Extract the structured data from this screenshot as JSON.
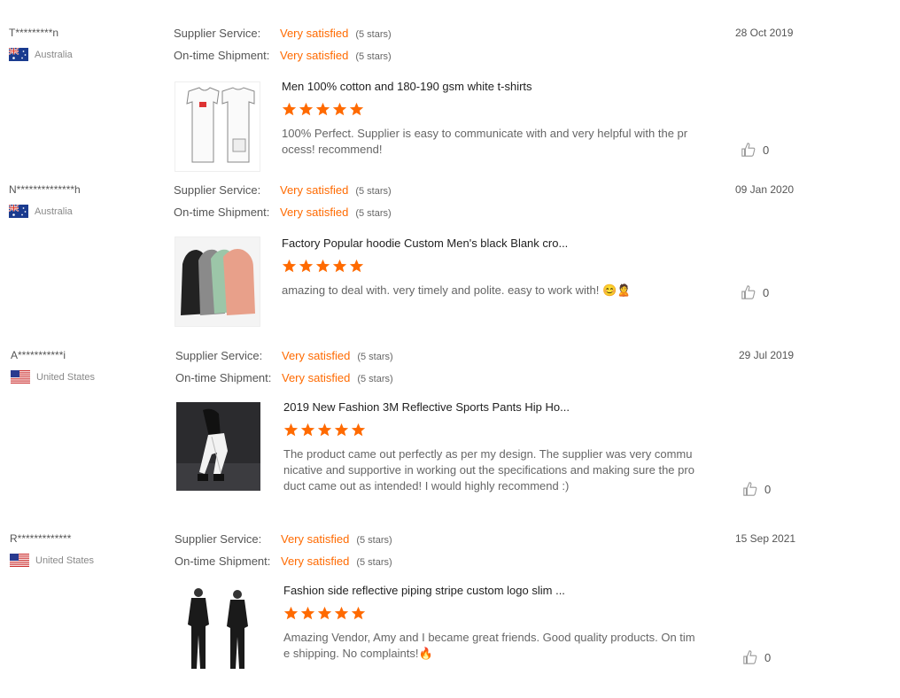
{
  "labels": {
    "supplier_service": "Supplier Service:",
    "ontime_shipment": "On-time Shipment:"
  },
  "colors": {
    "accent": "#ff6a00",
    "star": "#ff6a00"
  },
  "reviews": [
    {
      "reviewer": "T*********n",
      "country": "Australia",
      "flag": "au",
      "supplier_service": "Very satisfied",
      "supplier_service_stars": "(5 stars)",
      "ontime_shipment": "Very satisfied",
      "ontime_shipment_stars": "(5 stars)",
      "date": "28 Oct 2019",
      "product_title": "Men 100% cotton and 180-190 gsm white t-shirts",
      "rating": 5,
      "comment": "100% Perfect. Supplier is easy to communicate with and very helpful with the process! recommend!",
      "likes": "0",
      "thumb_icon": "white-tshirt-image"
    },
    {
      "reviewer": "N**************h",
      "country": "Australia",
      "flag": "au",
      "supplier_service": "Very satisfied",
      "supplier_service_stars": "(5 stars)",
      "ontime_shipment": "Very satisfied",
      "ontime_shipment_stars": "(5 stars)",
      "date": "09 Jan 2020",
      "product_title": "Factory Popular hoodie Custom Men's black Blank cro...",
      "rating": 5,
      "comment": "amazing to deal with. very timely and polite. easy to work with! 😊🙎",
      "likes": "0",
      "thumb_icon": "hoodies-image"
    },
    {
      "reviewer": "A***********i",
      "country": "United States",
      "flag": "us",
      "supplier_service": "Very satisfied",
      "supplier_service_stars": "(5 stars)",
      "ontime_shipment": "Very satisfied",
      "ontime_shipment_stars": "(5 stars)",
      "date": "29 Jul 2019",
      "product_title": "2019 New Fashion 3M Reflective Sports Pants Hip Ho...",
      "rating": 5,
      "comment": "The product came out perfectly as per my design. The supplier was very communicative and supportive in working out the specifications and making sure the product came out as intended! I would highly recommend :)",
      "likes": "0",
      "thumb_icon": "reflective-pants-image"
    },
    {
      "reviewer": "R*************",
      "country": "United States",
      "flag": "us",
      "supplier_service": "Very satisfied",
      "supplier_service_stars": "(5 stars)",
      "ontime_shipment": "Very satisfied",
      "ontime_shipment_stars": "(5 stars)",
      "date": "15 Sep 2021",
      "product_title": "Fashion side reflective piping stripe custom logo slim ...",
      "rating": 5,
      "comment": "Amazing Vendor, Amy and I became great friends. Good quality products. On time shipping. No complaints!🔥",
      "likes": "0",
      "thumb_icon": "black-tracksuit-image"
    }
  ]
}
